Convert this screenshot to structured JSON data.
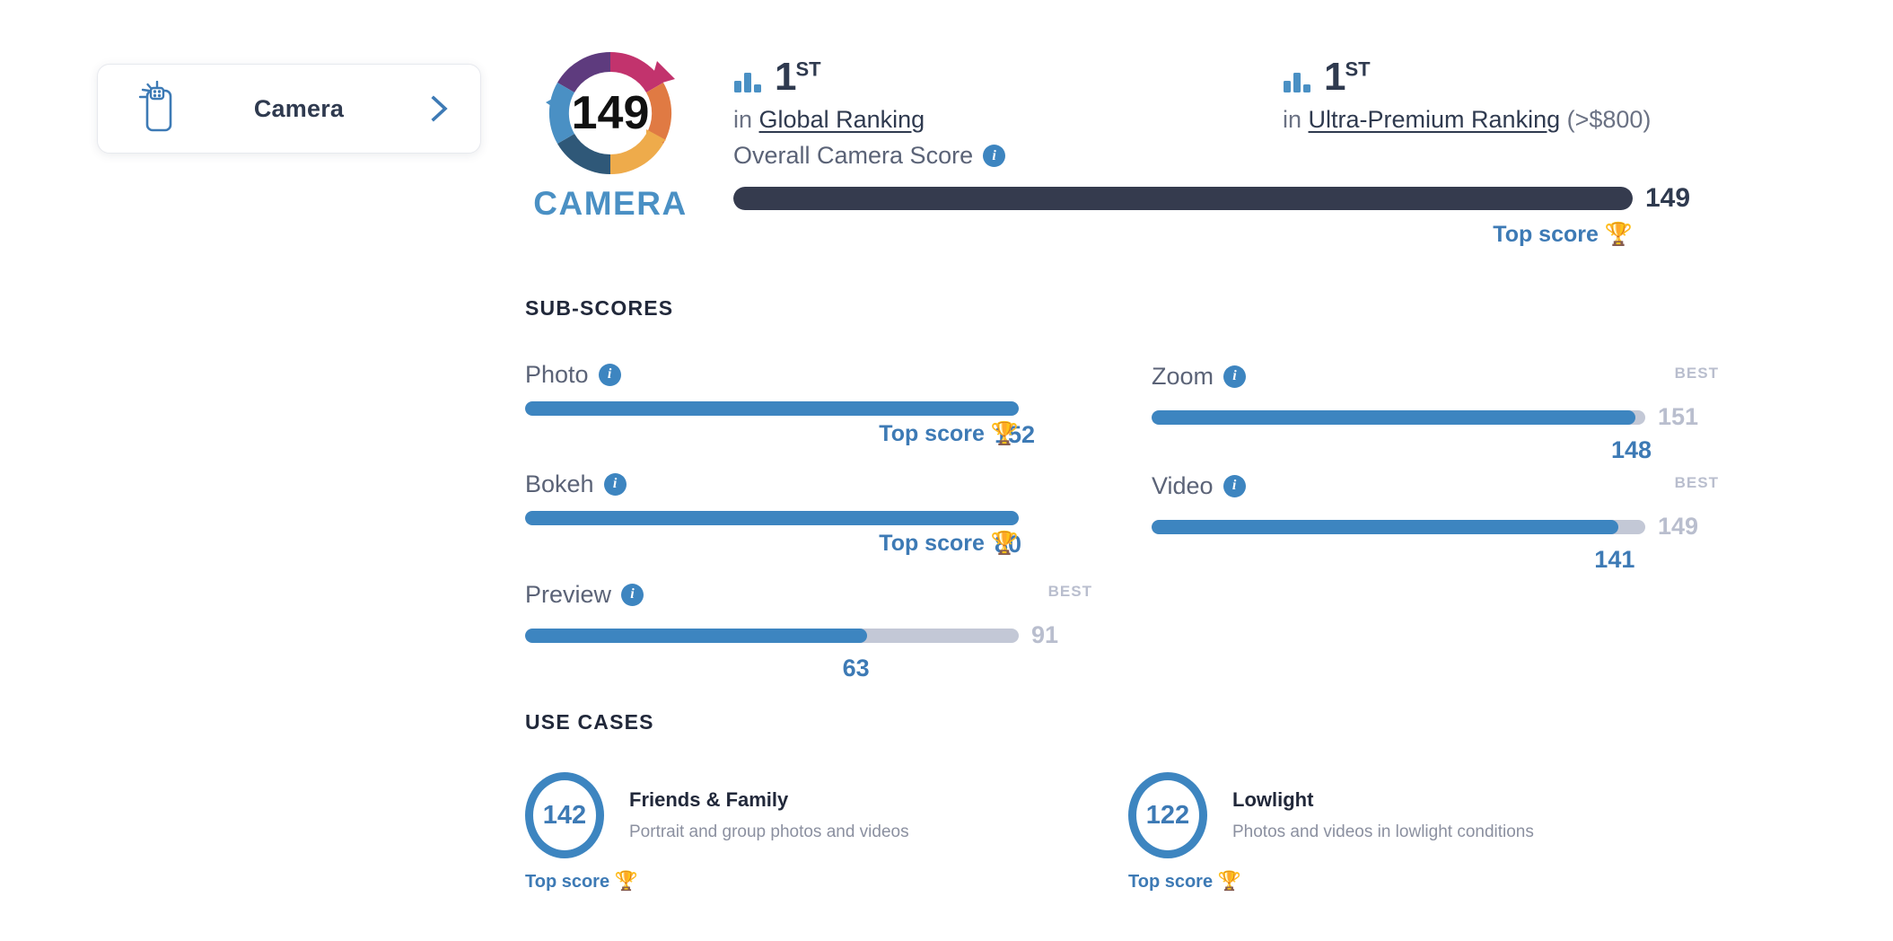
{
  "device_card": {
    "label": "Camera",
    "icon": "phone-camera-icon",
    "chevron": "chevron-right-icon"
  },
  "badge": {
    "score": "149",
    "word": "CAMERA",
    "colors": {
      "magenta": "#c2336d",
      "purple": "#5e3b7e",
      "orange": "#e07a43",
      "gold": "#eeab4b",
      "blue": "#4a90c4",
      "navy": "#2f5878"
    }
  },
  "rankings": [
    {
      "icon": "bar-chart-icon",
      "rank": "1",
      "rank_suffix": "ST",
      "prefix": "in ",
      "link": "Global Ranking",
      "suffix": ""
    },
    {
      "icon": "bar-chart-icon",
      "rank": "1",
      "rank_suffix": "ST",
      "prefix": "in ",
      "link": "Ultra-Premium Ranking",
      "suffix": " (>$800)"
    }
  ],
  "overall": {
    "label": "Overall Camera Score",
    "info": "info-icon",
    "value": "149",
    "fill_percent": 100,
    "top_score_label": "Top score",
    "trophy": "🏆"
  },
  "sections": {
    "subscores_title": "SUB-SCORES",
    "usecases_title": "USE CASES"
  },
  "subscores": [
    {
      "name": "Photo",
      "value": "152",
      "best": null,
      "best_label": "",
      "fill_percent": 100,
      "top_score": "Top score",
      "is_top": true
    },
    {
      "name": "Zoom",
      "value": "148",
      "best": "151",
      "best_label": "BEST",
      "fill_percent": 98.0,
      "top_score": "",
      "is_top": false
    },
    {
      "name": "Bokeh",
      "value": "80",
      "best": null,
      "best_label": "",
      "fill_percent": 100,
      "top_score": "Top score",
      "is_top": true
    },
    {
      "name": "Video",
      "value": "141",
      "best": "149",
      "best_label": "BEST",
      "fill_percent": 94.6,
      "top_score": "",
      "is_top": false
    },
    {
      "name": "Preview",
      "value": "63",
      "best": "91",
      "best_label": "BEST",
      "fill_percent": 69.2,
      "top_score": "",
      "is_top": false
    }
  ],
  "usecases": [
    {
      "score": "142",
      "title": "Friends & Family",
      "description": "Portrait and group photos and videos",
      "top_score": "Top score",
      "trophy": "🏆"
    },
    {
      "score": "122",
      "title": "Lowlight",
      "description": "Photos and videos in lowlight conditions",
      "top_score": "Top score",
      "trophy": "🏆"
    }
  ]
}
